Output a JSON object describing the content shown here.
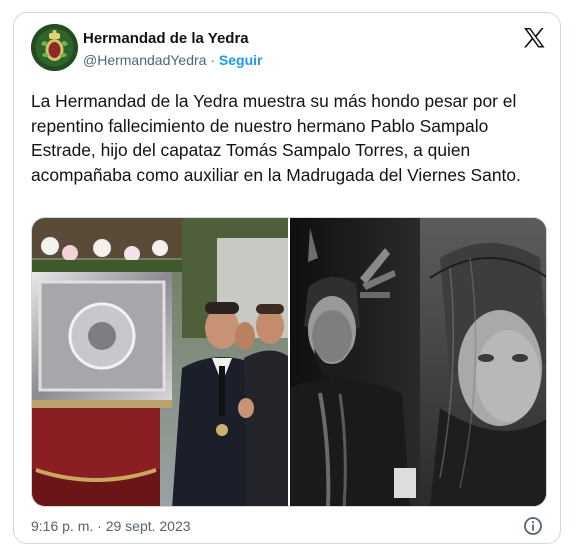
{
  "tweet": {
    "author_name": "Hermandad de la Yedra",
    "handle": "@HermandadYedra",
    "separator": " · ",
    "follow_label": "Seguir",
    "text": "La Hermandad de la Yedra muestra su más hondo pesar por el repentino fallecimiento de nuestro hermano Pablo Sampalo Estrade, hijo del capataz Tomás Sampalo Torres, a quien acompañaba como auxiliar en la Madrugada del Viernes Santo.",
    "timestamp": "9:16 p. m. · 29 sept. 2023"
  },
  "icons": {
    "platform": "x-logo-icon",
    "info": "info-icon",
    "avatar": "brotherhood-crest-avatar"
  },
  "media": {
    "left_photo": "procession-float-photo",
    "right_photo": "religious-images-bw-photo"
  },
  "colors": {
    "accent": "#1d9bf0",
    "text": "#0f1419",
    "secondary": "#536471",
    "border": "#cfd9de"
  }
}
